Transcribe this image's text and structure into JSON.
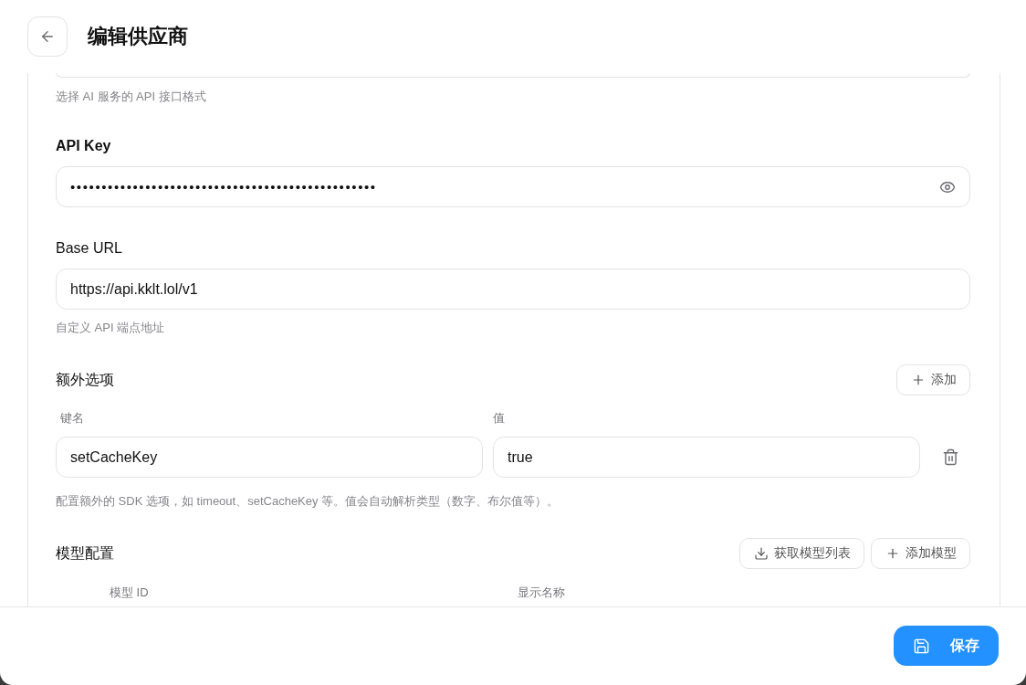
{
  "header": {
    "title": "编辑供应商"
  },
  "form": {
    "api_format": {
      "hint": "选择 AI 服务的 API 接口格式"
    },
    "api_key": {
      "label": "API Key",
      "value": "•••••••••••••••••••••••••••••••••••••••••••••••••"
    },
    "base_url": {
      "label": "Base URL",
      "value": "https://api.kklt.lol/v1",
      "hint": "自定义 API 端点地址"
    },
    "extra_options": {
      "title": "额外选项",
      "add_button": "添加",
      "columns": [
        "键名",
        "值"
      ],
      "rows": [
        {
          "key": "setCacheKey",
          "value": "true"
        }
      ],
      "hint": "配置额外的 SDK 选项，如 timeout、setCacheKey 等。值会自动解析类型（数字、布尔值等）。"
    },
    "models": {
      "title": "模型配置",
      "buttons": [
        {
          "kind": "fetch",
          "label": "获取模型列表"
        },
        {
          "kind": "add",
          "label": "添加模型"
        }
      ],
      "columns": [
        "模型 ID",
        "显示名称"
      ]
    }
  },
  "footer": {
    "save_button": "保存"
  }
}
